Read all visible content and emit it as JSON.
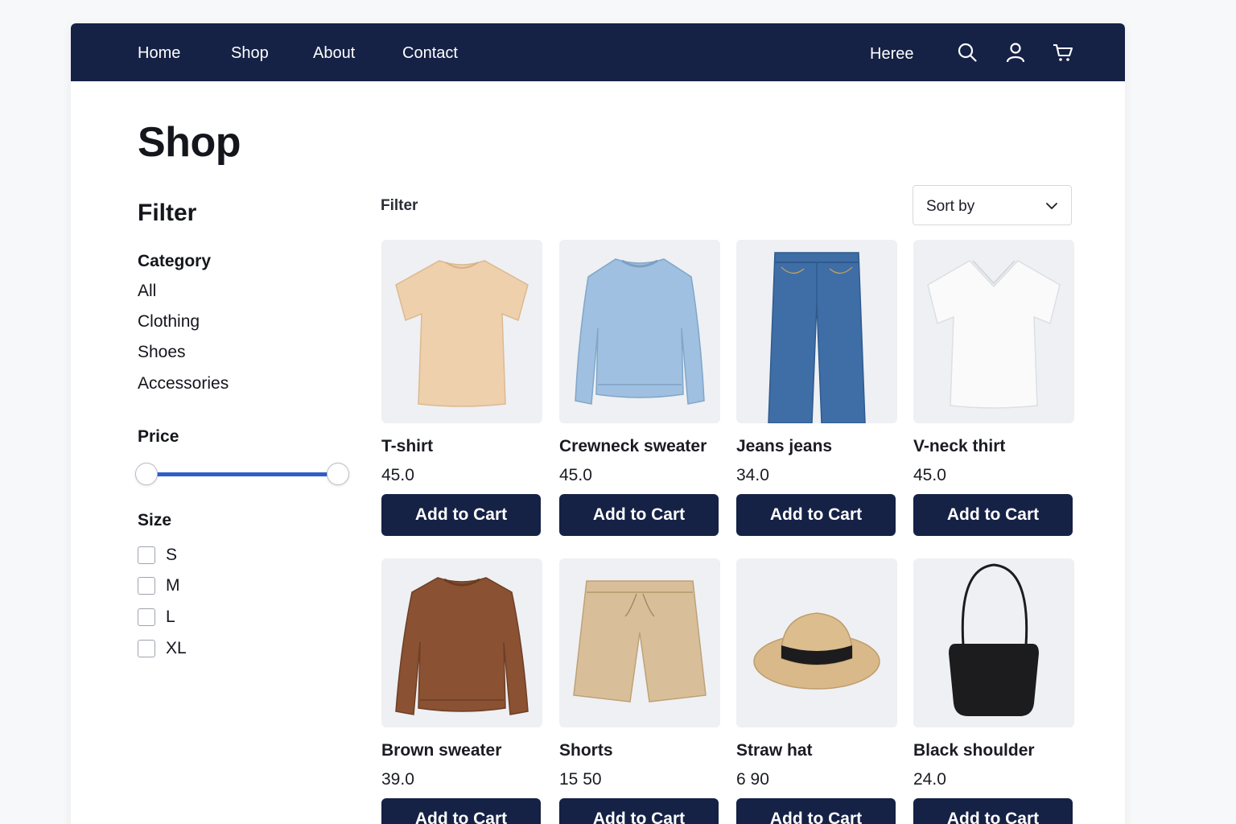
{
  "nav": {
    "links": [
      "Home",
      "Shop",
      "About",
      "Contact"
    ],
    "right_text": "Heree",
    "icons": [
      "search-icon",
      "user-icon",
      "cart-icon"
    ]
  },
  "page": {
    "title": "Shop"
  },
  "sidebar": {
    "heading": "Filter",
    "category_label": "Category",
    "categories": [
      "All",
      "Clothing",
      "Shoes",
      "Accessories"
    ],
    "price_label": "Price",
    "price_range": {
      "low": 0.0,
      "high": 1.0
    },
    "size_label": "Size",
    "sizes": [
      "S",
      "M",
      "L",
      "XL"
    ]
  },
  "toolbar": {
    "filter_label": "Filter",
    "sort_label": "Sort by"
  },
  "products": [
    {
      "name": "T-shirt",
      "price": "45.0",
      "button": "Add to Cart",
      "image": "tshirt-image",
      "color": "#efd0ad"
    },
    {
      "name": "Crewneck sweater",
      "price": "45.0",
      "button": "Add to Cart",
      "image": "sweater-image",
      "color": "#9fc0e0"
    },
    {
      "name": "Jeans jeans",
      "price": "34.0",
      "button": "Add to Cart",
      "image": "jeans-image",
      "color": "#3f6ea7"
    },
    {
      "name": "V-neck thirt",
      "price": "45.0",
      "button": "Add to Cart",
      "image": "vneck-image",
      "color": "#fafafa"
    },
    {
      "name": "Brown sweater",
      "price": "39.0",
      "button": "Add to Cart",
      "image": "brown-sweater-image",
      "color": "#8a5132"
    },
    {
      "name": "Shorts",
      "price": "15 50",
      "button": "Add to Cart",
      "image": "shorts-image",
      "color": "#d9bf99"
    },
    {
      "name": "Straw hat",
      "price": "6 90",
      "button": "Add to Cart",
      "image": "straw-hat-image",
      "color": "#d9b98a"
    },
    {
      "name": "Black shoulder",
      "price": "24.0",
      "button": "Add to Cart",
      "image": "bag-image",
      "color": "#1c1c1e"
    }
  ],
  "colors": {
    "navbar": "#152145",
    "accent": "#2e5fc9",
    "button": "#152145"
  }
}
